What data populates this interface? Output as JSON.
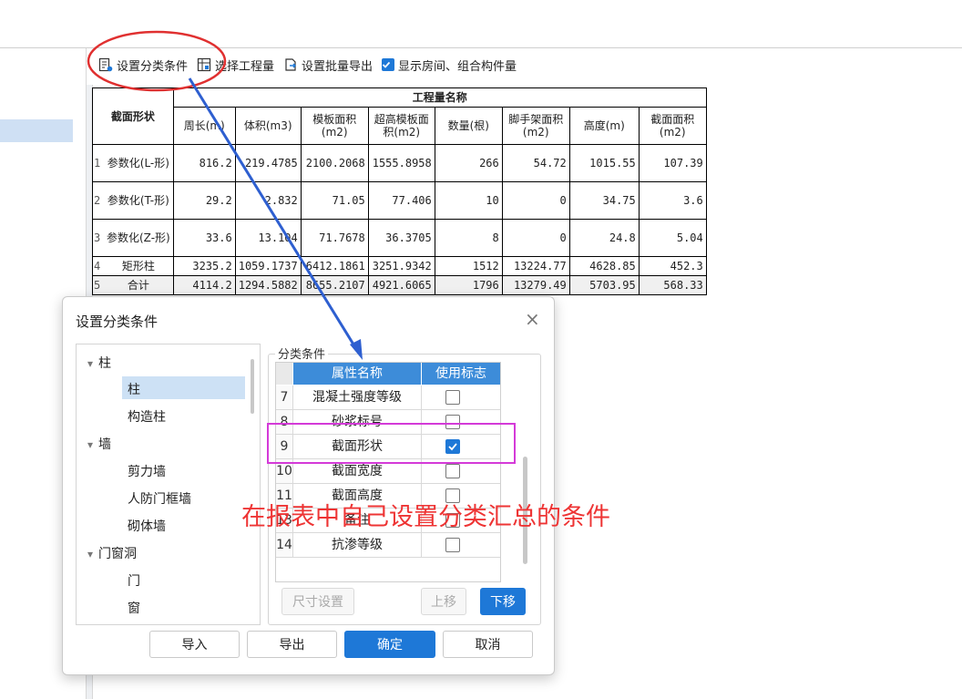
{
  "toolbar": {
    "set_classify": "设置分类条件",
    "select_quantity": "选择工程量",
    "batch_export": "设置批量导出",
    "show_rooms": "显示房间、组合构件量"
  },
  "report": {
    "header_group": "工程量名称",
    "row_header": "截面形状",
    "columns": [
      "周长(m)",
      "体积(m3)",
      "模板面积(m2)",
      "超高模板面积(m2)",
      "数量(根)",
      "脚手架面积(m2)",
      "高度(m)",
      "截面面积(m2)"
    ],
    "rows": [
      {
        "index": "1",
        "name": "参数化(L-形)",
        "values": [
          "816.2",
          "219.4785",
          "2100.2068",
          "1555.8958",
          "266",
          "54.72",
          "1015.55",
          "107.39"
        ]
      },
      {
        "index": "2",
        "name": "参数化(T-形)",
        "values": [
          "29.2",
          "2.832",
          "71.05",
          "77.406",
          "10",
          "0",
          "34.75",
          "3.6"
        ]
      },
      {
        "index": "3",
        "name": "参数化(Z-形)",
        "values": [
          "33.6",
          "13.104",
          "71.7678",
          "36.3705",
          "8",
          "0",
          "24.8",
          "5.04"
        ]
      },
      {
        "index": "4",
        "name": "矩形柱",
        "values": [
          "3235.2",
          "1059.1737",
          "6412.1861",
          "3251.9342",
          "1512",
          "13224.77",
          "4628.85",
          "452.3"
        ]
      },
      {
        "index": "5",
        "name": "合计",
        "values": [
          "4114.2",
          "1294.5882",
          "8655.2107",
          "4921.6065",
          "1796",
          "13279.49",
          "5703.95",
          "568.33"
        ]
      }
    ]
  },
  "dialog": {
    "title": "设置分类条件",
    "close": "×",
    "tree": [
      {
        "label": "柱",
        "expander": "▾",
        "level": 0
      },
      {
        "label": "柱",
        "level": 1,
        "selected": true
      },
      {
        "label": "构造柱",
        "level": 1
      },
      {
        "label": "墙",
        "expander": "▾",
        "level": 0
      },
      {
        "label": "剪力墙",
        "level": 1
      },
      {
        "label": "人防门框墙",
        "level": 1
      },
      {
        "label": "砌体墙",
        "level": 1
      },
      {
        "label": "门窗洞",
        "expander": "▾",
        "level": 0
      },
      {
        "label": "门",
        "level": 1
      },
      {
        "label": "窗",
        "level": 1
      }
    ],
    "group_label": "分类条件",
    "grid_headers": {
      "name": "属性名称",
      "flag": "使用标志"
    },
    "grid_rows": [
      {
        "index": "7",
        "name": "混凝土强度等级",
        "checked": false
      },
      {
        "index": "8",
        "name": "砂浆标号",
        "checked": false
      },
      {
        "index": "9",
        "name": "截面形状",
        "checked": true
      },
      {
        "index": "10",
        "name": "截面宽度",
        "checked": false
      },
      {
        "index": "11",
        "name": "截面高度",
        "checked": false
      },
      {
        "index": "13",
        "name": "备注",
        "checked": false
      },
      {
        "index": "14",
        "name": "抗渗等级",
        "checked": false
      }
    ],
    "buttons": {
      "size_setting": "尺寸设置",
      "move_up": "上移",
      "move_down": "下移",
      "import": "导入",
      "export": "导出",
      "ok": "确定",
      "cancel": "取消"
    }
  },
  "annotation": {
    "text": "在报表中自己设置分类汇总的条件",
    "color_text": "#ee3434",
    "color_ellipse": "#e03030",
    "color_arrow": "#2e5fd0",
    "color_box": "#d43ad8"
  }
}
